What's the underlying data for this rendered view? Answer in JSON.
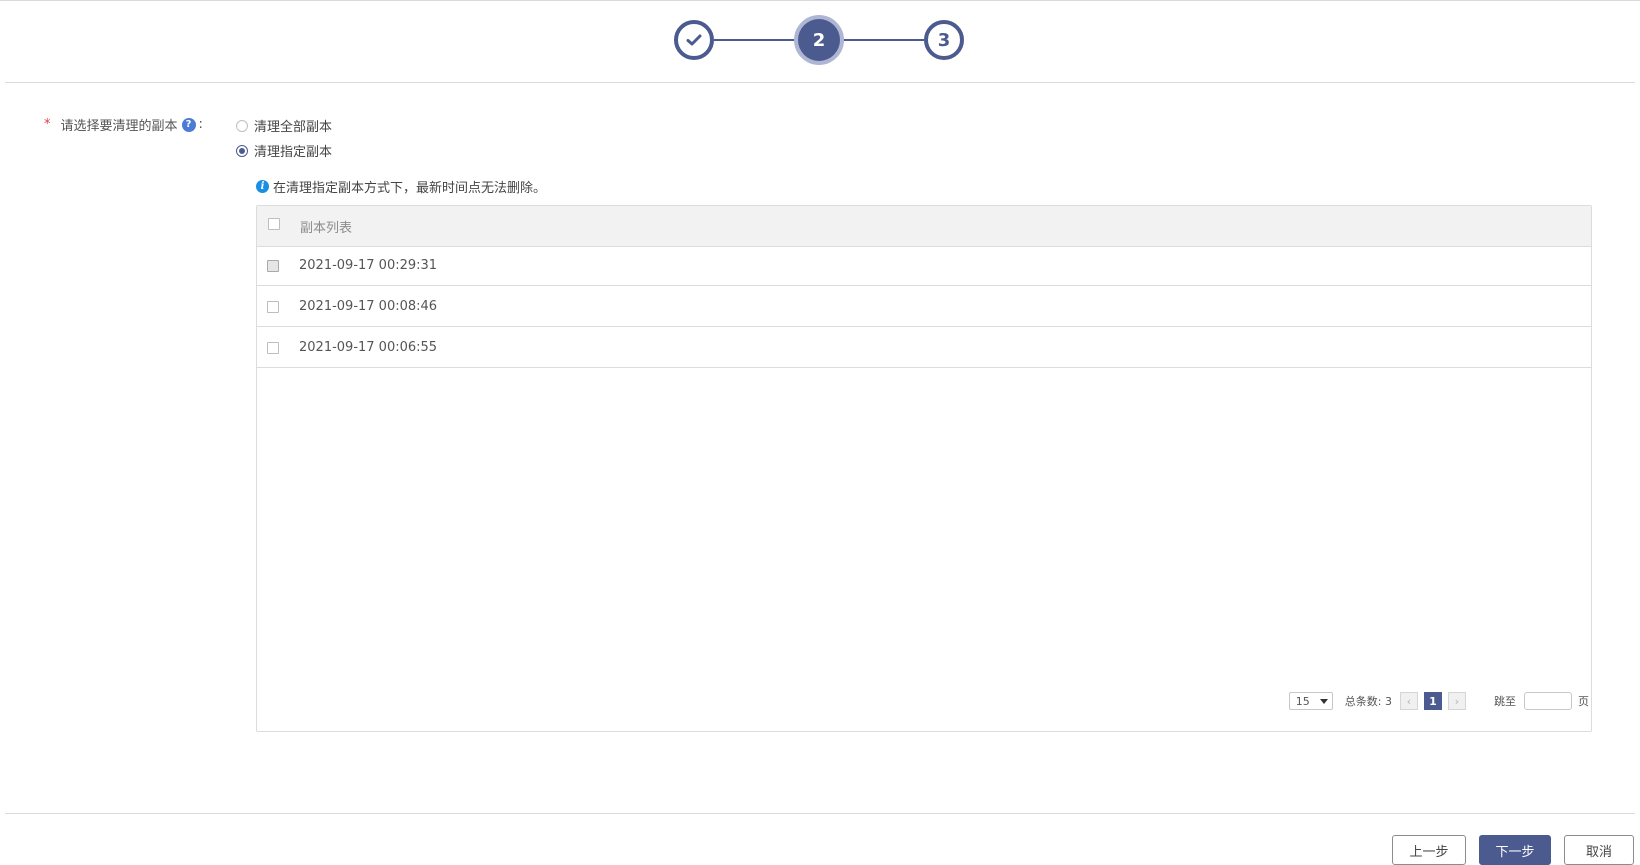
{
  "stepper": {
    "steps": [
      {
        "label": "",
        "state": "done",
        "icon": "check-icon"
      },
      {
        "label": "2",
        "state": "current"
      },
      {
        "label": "3",
        "state": "pending"
      }
    ]
  },
  "form": {
    "required_mark": "*",
    "label": "请选择要清理的副本",
    "help_icon_glyph": "?",
    "colon": ":",
    "options": [
      {
        "label": "清理全部副本",
        "checked": false
      },
      {
        "label": "清理指定副本",
        "checked": true
      }
    ],
    "info_icon_glyph": "i",
    "info_text": "在清理指定副本方式下，最新时间点无法删除。"
  },
  "table": {
    "header": "副本列表",
    "rows": [
      {
        "label": "2021-09-17 00:29:31",
        "disabled": true
      },
      {
        "label": "2021-09-17 00:08:46",
        "disabled": false
      },
      {
        "label": "2021-09-17 00:06:55",
        "disabled": false
      }
    ]
  },
  "pagination": {
    "page_size": "15",
    "total_label": "总条数: 3",
    "prev_glyph": "‹",
    "current_page": "1",
    "next_glyph": "›",
    "goto_label": "跳至",
    "goto_value": "",
    "page_unit": "页"
  },
  "footer": {
    "prev_label": "上一步",
    "next_label": "下一步",
    "cancel_label": "取消"
  },
  "colors": {
    "primary": "#4b5a8f",
    "step_halo": "#aeb6d4",
    "required": "#e4393c",
    "info": "#1a8fe3"
  }
}
